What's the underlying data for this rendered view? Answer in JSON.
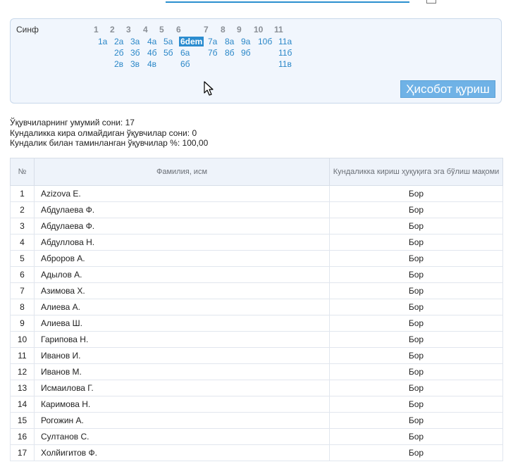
{
  "filter": {
    "label": "Синф",
    "grades": [
      {
        "label": "1",
        "classes": [
          "1а"
        ]
      },
      {
        "label": "2",
        "classes": [
          "2а",
          "2б",
          "2в"
        ]
      },
      {
        "label": "3",
        "classes": [
          "3а",
          "3б",
          "3в"
        ]
      },
      {
        "label": "4",
        "classes": [
          "4а",
          "4б",
          "4в"
        ]
      },
      {
        "label": "5",
        "classes": [
          "5а",
          "5б"
        ]
      },
      {
        "label": "6",
        "classes": [
          "6dem",
          "6а",
          "6б"
        ]
      },
      {
        "label": "7",
        "classes": [
          "7а",
          "7б"
        ]
      },
      {
        "label": "8",
        "classes": [
          "8а",
          "8б"
        ]
      },
      {
        "label": "9",
        "classes": [
          "9а",
          "9б"
        ]
      },
      {
        "label": "10",
        "classes": [
          "10б"
        ]
      },
      {
        "label": "11",
        "classes": [
          "11а",
          "11б",
          "11в"
        ]
      }
    ],
    "selected_class": "6dem",
    "report_button": "Ҳисобот қуриш"
  },
  "stats": {
    "total_label": "Ўқувчиларнинг умумий сони:",
    "total_value": "17",
    "no_access_label": "Кундаликка кира олмайдиган ўқувчилар сони:",
    "no_access_value": "0",
    "percent_label": "Кундалик билан таминланган ўқувчилар %:",
    "percent_value": "100,00"
  },
  "table": {
    "headers": [
      "№",
      "Фамилия, исм",
      "Кундаликка кириш ҳуқуқига эга бўлиш мақоми"
    ],
    "rows": [
      {
        "num": "1",
        "name": "Azizova E.",
        "status": "Бор"
      },
      {
        "num": "2",
        "name": "Абдулаева Ф.",
        "status": "Бор"
      },
      {
        "num": "3",
        "name": "Абдулаева Ф.",
        "status": "Бор"
      },
      {
        "num": "4",
        "name": "Абдуллова Н.",
        "status": "Бор"
      },
      {
        "num": "5",
        "name": "Аброров А.",
        "status": "Бор"
      },
      {
        "num": "6",
        "name": "Адылов А.",
        "status": "Бор"
      },
      {
        "num": "7",
        "name": "Азимова Х.",
        "status": "Бор"
      },
      {
        "num": "8",
        "name": "Алиева А.",
        "status": "Бор"
      },
      {
        "num": "9",
        "name": "Алиева Ш.",
        "status": "Бор"
      },
      {
        "num": "10",
        "name": "Гарипова Н.",
        "status": "Бор"
      },
      {
        "num": "11",
        "name": "Иванов И.",
        "status": "Бор"
      },
      {
        "num": "12",
        "name": "Иванов М.",
        "status": "Бор"
      },
      {
        "num": "13",
        "name": "Исмаилова Г.",
        "status": "Бор"
      },
      {
        "num": "14",
        "name": "Каримова Н.",
        "status": "Бор"
      },
      {
        "num": "15",
        "name": "Рогожин А.",
        "status": "Бор"
      },
      {
        "num": "16",
        "name": "Султанов С.",
        "status": "Бор"
      },
      {
        "num": "17",
        "name": "Холйигитов Ф.",
        "status": "Бор"
      }
    ]
  }
}
